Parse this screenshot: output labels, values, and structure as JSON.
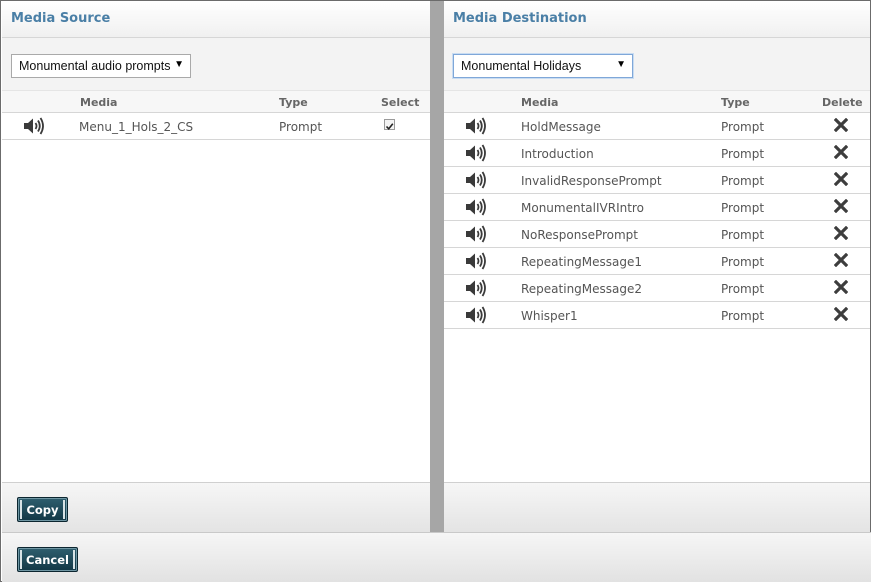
{
  "source": {
    "title": "Media Source",
    "select_value": "Monumental audio prompts",
    "columns": {
      "media": "Media",
      "type": "Type",
      "select": "Select"
    },
    "rows": [
      {
        "media": "Menu_1_Hols_2_CS",
        "type": "Prompt",
        "selected": true
      }
    ],
    "copy_label": "Copy"
  },
  "destination": {
    "title": "Media Destination",
    "select_value": "Monumental Holidays",
    "columns": {
      "media": "Media",
      "type": "Type",
      "delete": "Delete"
    },
    "rows": [
      {
        "media": "HoldMessage",
        "type": "Prompt"
      },
      {
        "media": "Introduction",
        "type": "Prompt"
      },
      {
        "media": "InvalidResponsePrompt",
        "type": "Prompt"
      },
      {
        "media": "MonumentalIVRIntro",
        "type": "Prompt"
      },
      {
        "media": "NoResponsePrompt",
        "type": "Prompt"
      },
      {
        "media": "RepeatingMessage1",
        "type": "Prompt"
      },
      {
        "media": "RepeatingMessage2",
        "type": "Prompt"
      },
      {
        "media": "Whisper1",
        "type": "Prompt"
      }
    ]
  },
  "footer": {
    "cancel_label": "Cancel"
  },
  "icons": {
    "play": "speaker-icon",
    "delete": "delete-x-icon",
    "dropdown": "dropdown-arrow-icon"
  },
  "colors": {
    "title": "#4a7fa6",
    "button": "#1f4a58",
    "divider": "#a6a6a6"
  }
}
